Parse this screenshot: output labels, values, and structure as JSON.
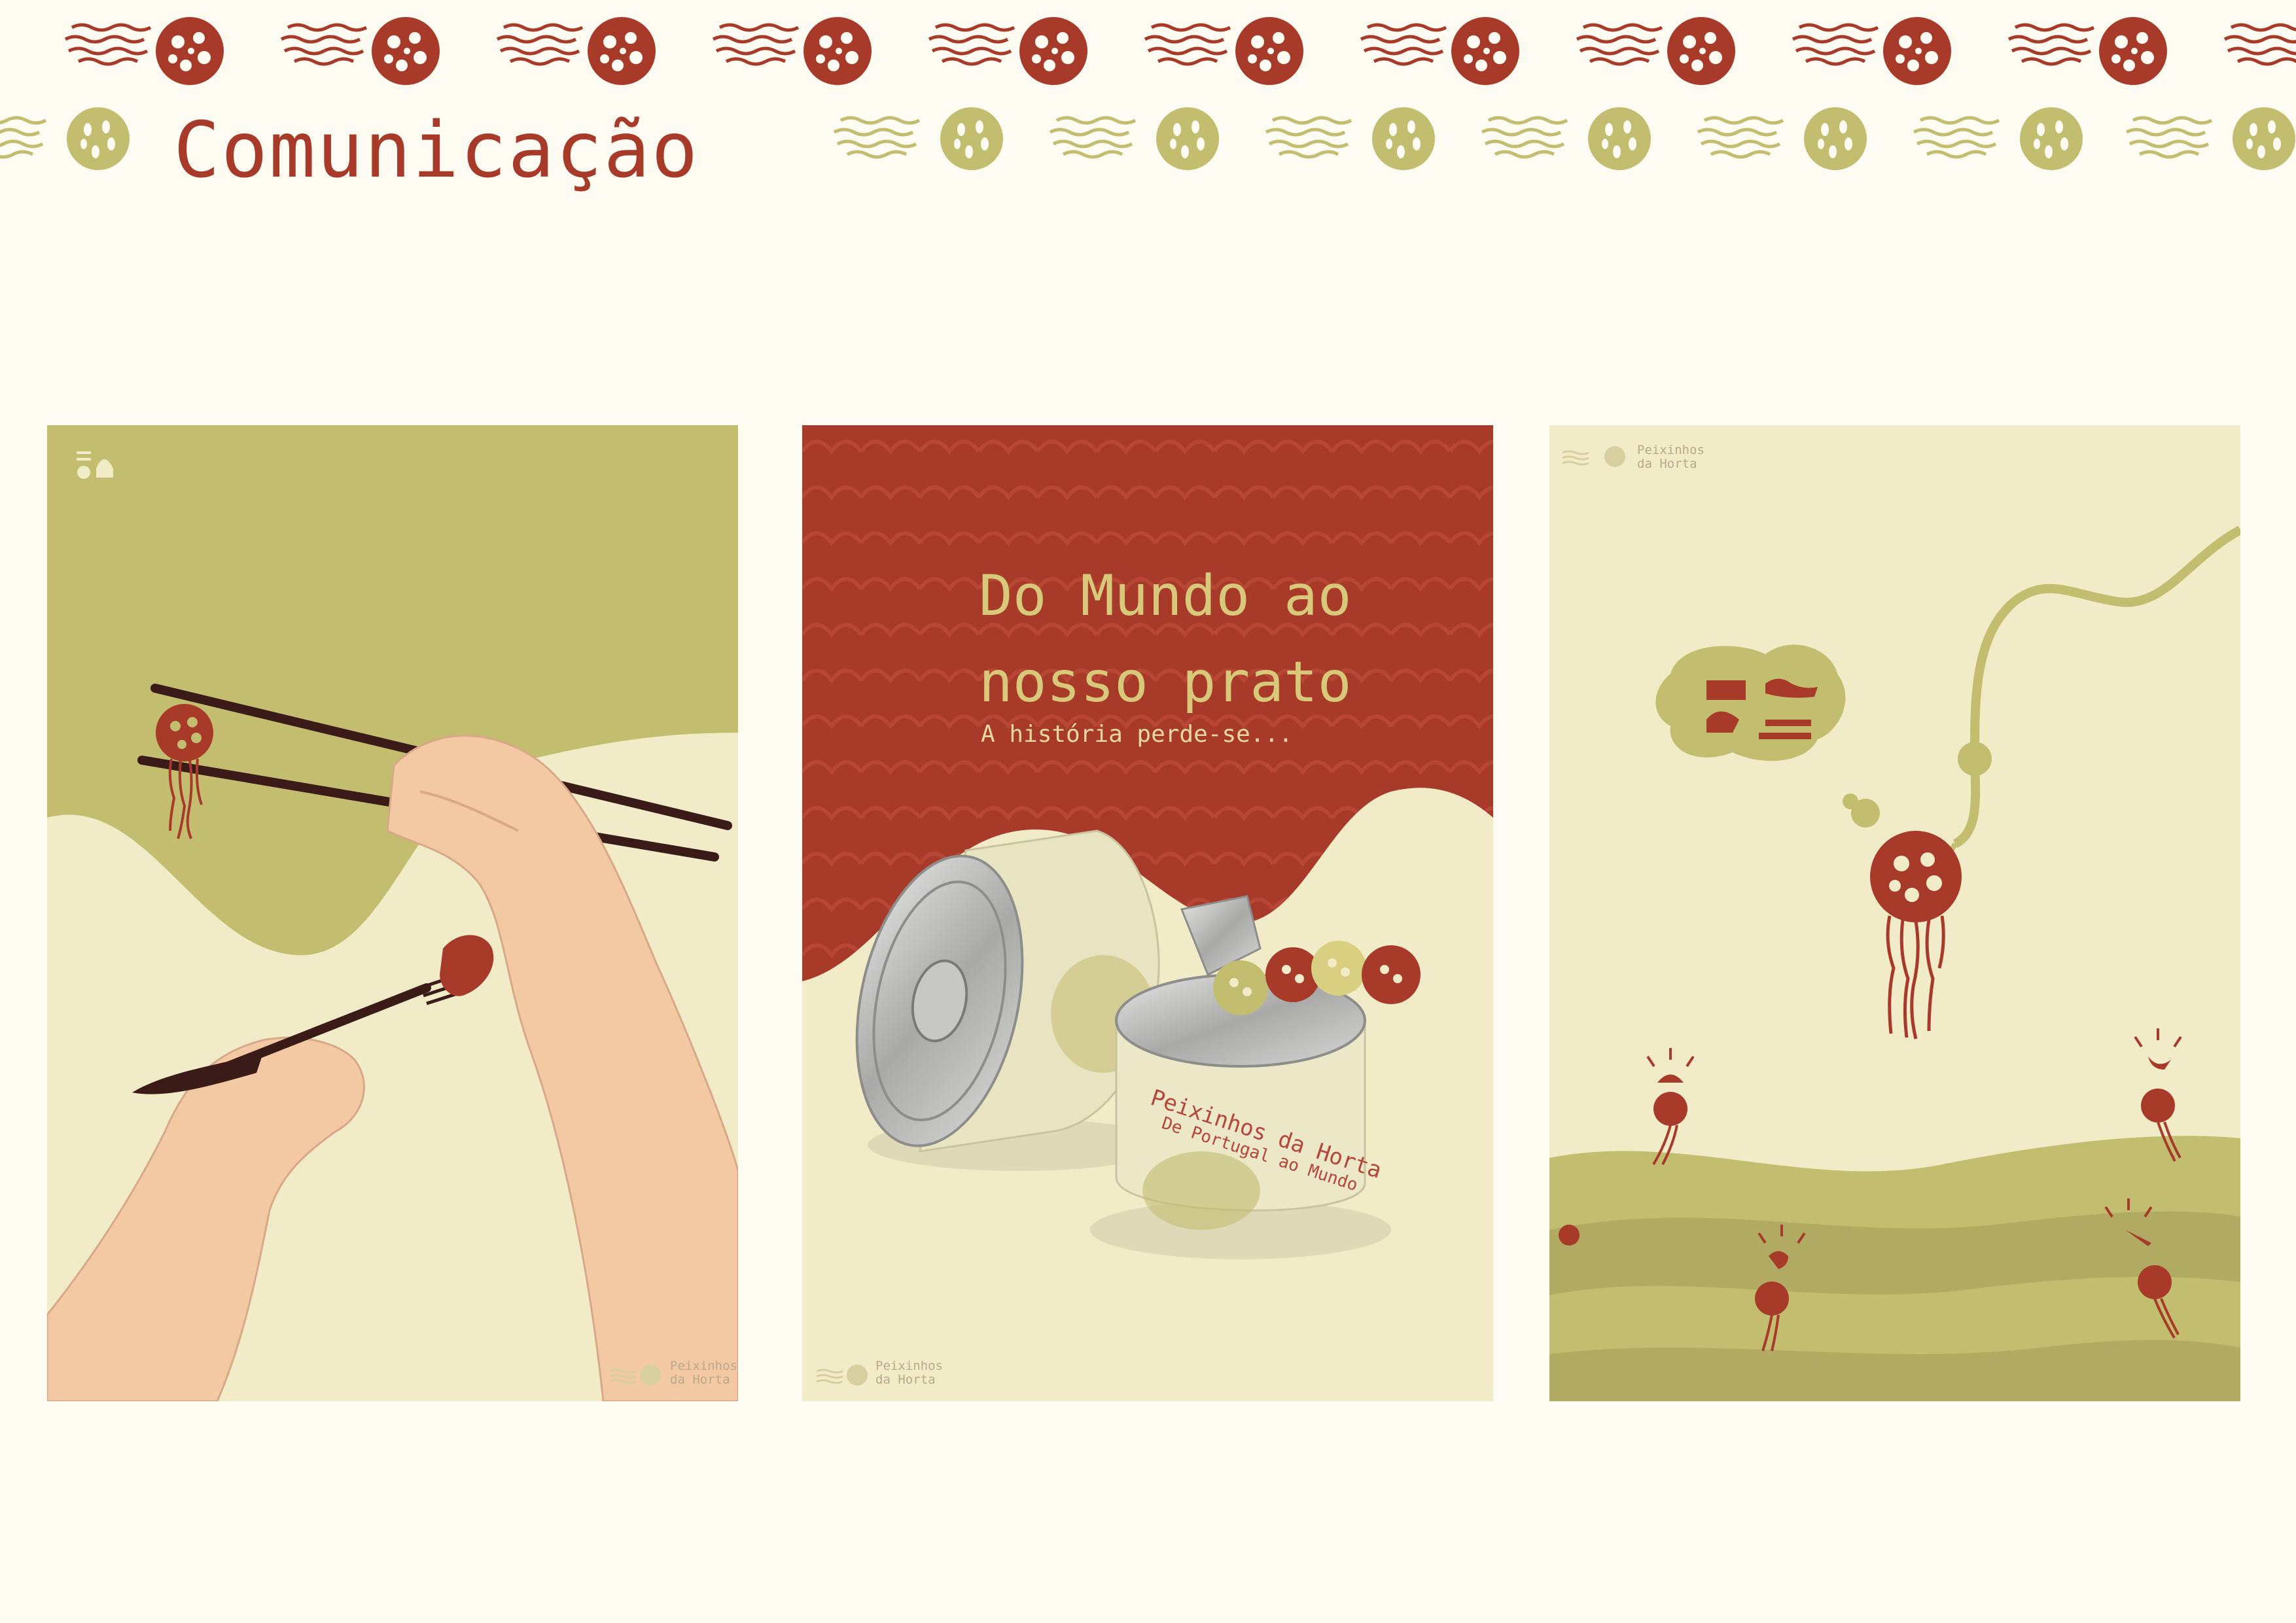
{
  "page": {
    "title": "Comunicação"
  },
  "posters": [
    {
      "brand": "Peixinhos\nda Horta"
    },
    {
      "headline": "Do Mundo ao\nnosso prato",
      "subline": "A história perde-se...",
      "can_title": "Peixinhos da Horta",
      "can_subtitle": "De Portugal ao Mundo",
      "brand": "Peixinhos\nda Horta"
    },
    {
      "brand": "Peixinhos\nda Horta"
    }
  ],
  "colors": {
    "red": "#a83a2a",
    "olive": "#c2bd6f",
    "cream": "#f1ebc8",
    "background": "#fdfbf2"
  }
}
